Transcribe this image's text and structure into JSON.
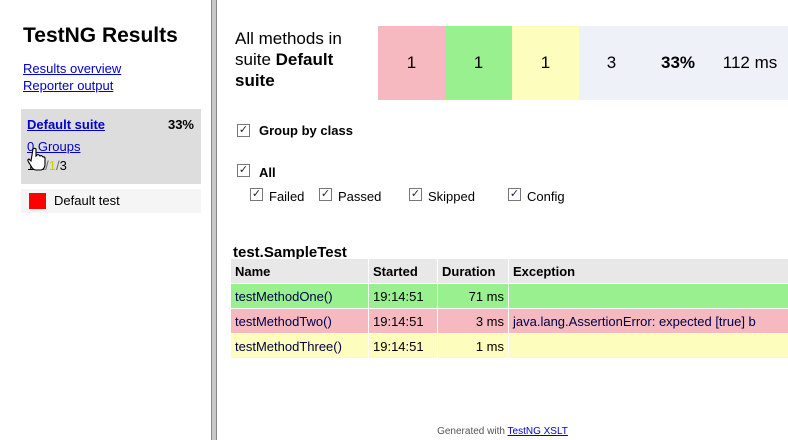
{
  "sidebar": {
    "title": "TestNG Results",
    "links": [
      "Results overview",
      "Reporter output"
    ],
    "suite": {
      "name": "Default suite",
      "percent": "33%",
      "groups_link": "0 Groups",
      "counts": {
        "failed": "1",
        "passed": "1",
        "skipped": "1",
        "total": "3",
        "sep": "/"
      }
    },
    "test": {
      "name": "Default test",
      "color": "#ff0000"
    }
  },
  "summary": {
    "title_prefix": "All methods in suite ",
    "suite_name": "Default suite",
    "cells": [
      {
        "value": "1",
        "color": "#f5b9bf"
      },
      {
        "value": "1",
        "color": "#99f08f"
      },
      {
        "value": "1",
        "color": "#fdfdbd"
      },
      {
        "value": "3",
        "color": "#eef2f8"
      },
      {
        "value": "33%",
        "color": "#eef2f8"
      },
      {
        "value": "112 ms",
        "color": "#eef2f8"
      }
    ]
  },
  "options": {
    "group_by_class": "Group by class",
    "all": "All",
    "filters": [
      "Failed",
      "Passed",
      "Skipped",
      "Config"
    ]
  },
  "results": {
    "class_name": "test.SampleTest",
    "columns": [
      "Name",
      "Started",
      "Duration",
      "Exception"
    ],
    "rows": [
      {
        "status": "pass",
        "name": "testMethodOne()",
        "started": "19:14:51",
        "duration": "71 ms",
        "exception": ""
      },
      {
        "status": "fail",
        "name": "testMethodTwo()",
        "started": "19:14:51",
        "duration": "3 ms",
        "exception": "java.lang.AssertionError: expected [true] b"
      },
      {
        "status": "skip",
        "name": "testMethodThree()",
        "started": "19:14:51",
        "duration": "1 ms",
        "exception": ""
      }
    ]
  },
  "footer": {
    "prefix": "Generated with ",
    "link": "TestNG XSLT"
  },
  "icons": {
    "cursor": "hand-pointer-icon",
    "checkbox": "checkmark-icon"
  }
}
